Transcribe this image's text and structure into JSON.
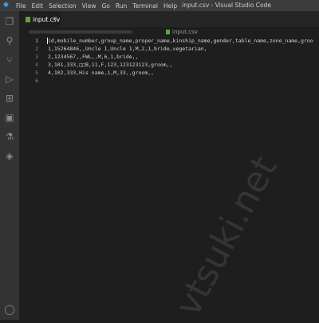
{
  "titlebar": {
    "menu": [
      "File",
      "Edit",
      "Selection",
      "View",
      "Go",
      "Run",
      "Terminal",
      "Help"
    ],
    "window_title": "input.csv - Visual Studio Code"
  },
  "activity_bar": {
    "icons": [
      "explorer-icon",
      "search-icon",
      "source-control-icon",
      "run-debug-icon",
      "extensions-icon",
      "remote-explorer-icon",
      "testing-icon",
      "docker-icon",
      "account-icon"
    ]
  },
  "tab": {
    "label": "input.csv",
    "close": "×"
  },
  "breadcrumb": {
    "file": "input.csv"
  },
  "editor": {
    "line_numbers": [
      "1",
      "2",
      "3",
      "4",
      "5",
      "6"
    ],
    "lines": [
      "id,mobile_number,group_name,proper_name,kinship_name,gender,table_name,zone_name,groo",
      "1,15264846,,Uncle 1,Uncle 1,M,2,1,bride,vegetarian,",
      "2,1234567,,FWL,,M,6,1,bride,,",
      "3,101,333,□□B,11,F,123,123123123,groom,,",
      "4,102,333,His name,1,M,33,,groom,,",
      ""
    ]
  },
  "watermark": "vtsuki.net",
  "colors": {
    "background": "#1e1e1e",
    "titlebar": "#3c3c3c",
    "activity_bar": "#333333",
    "csv_icon": "#5aa832"
  }
}
